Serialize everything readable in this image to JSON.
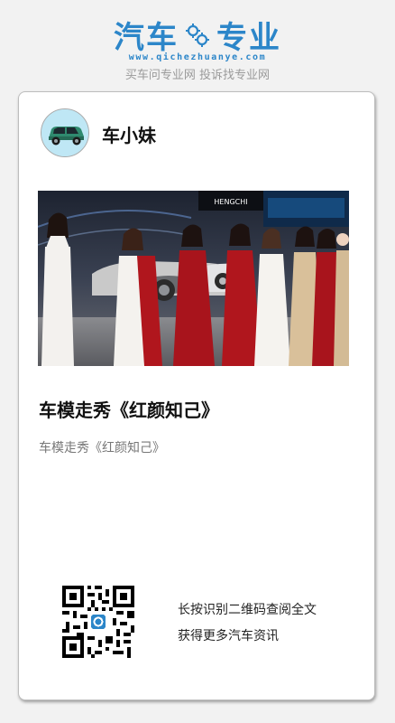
{
  "header": {
    "logo_left": "汽车",
    "logo_right": "专业",
    "url": "www.qichezhuanye.com",
    "tagline": "买车问专业网 投诉找专业网",
    "brand_color": "#2c86c9"
  },
  "card": {
    "author_name": "车小妹",
    "avatar_icon": "car-icon",
    "photo_sign": "HENGCHI",
    "article_title": "车模走秀《红颜知己》",
    "article_summary": "车模走秀《红颜知己》",
    "qr_icon": "qr-code-icon",
    "cta_line1": "长按识别二维码查阅全文",
    "cta_line2": "获得更多汽车资讯"
  }
}
